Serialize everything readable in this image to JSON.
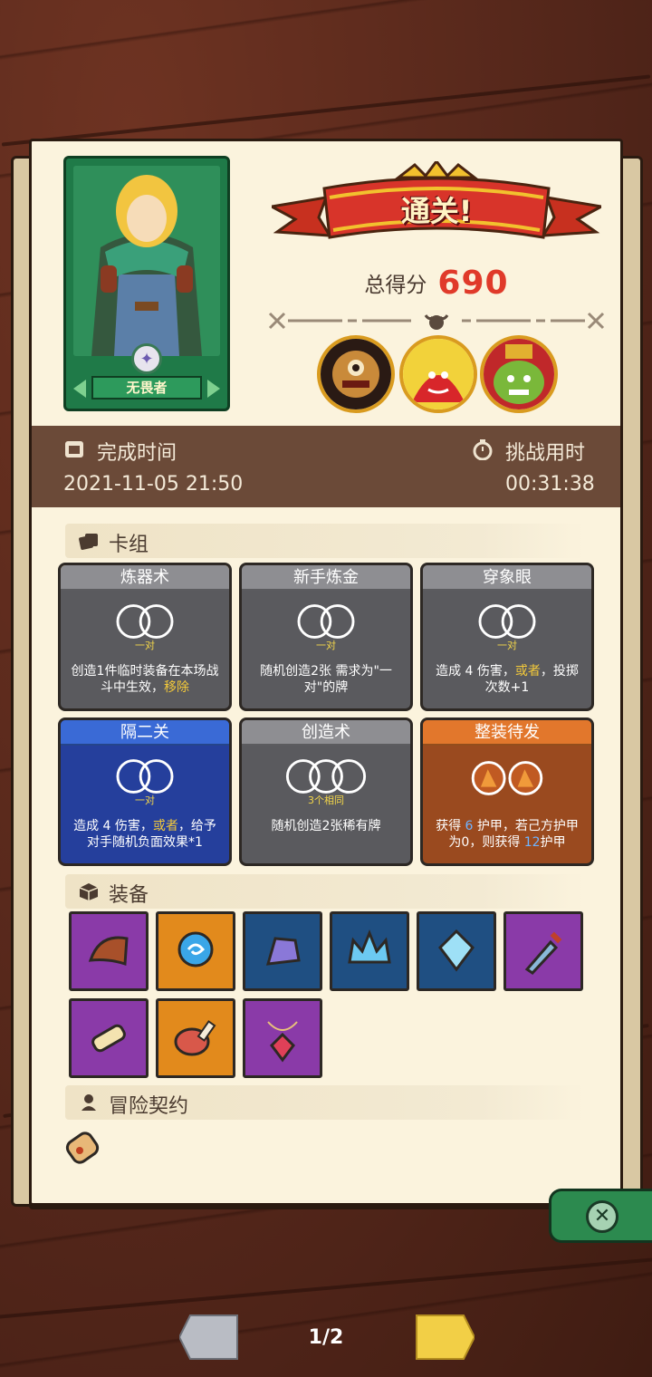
{
  "hero": {
    "name": "无畏者"
  },
  "banner": {
    "text": "通关!"
  },
  "score": {
    "label": "总得分",
    "value": "690"
  },
  "bosses": [
    "one-eyed-demon",
    "red-demon",
    "green-goblin-king"
  ],
  "time_bar": {
    "finish_label": "完成时间",
    "finish_value": "2021-11-05 21:50",
    "duration_label": "挑战用时",
    "duration_value": "00:31:38"
  },
  "deck": {
    "title": "卡组",
    "cards": [
      {
        "title": "炼器术",
        "dice": "一对",
        "desc_a": "创造1件临时装备在本场战斗中生效，",
        "desc_hl": "移除",
        "desc_b": ""
      },
      {
        "title": "新手炼金",
        "dice": "一对",
        "desc_a": "随机创造2张 需求为\"一对\"的牌",
        "desc_hl": "",
        "desc_b": ""
      },
      {
        "title": "穿象眼",
        "dice": "一对",
        "desc_a": "造成 4 伤害，",
        "desc_hl": "或者",
        "desc_b": "，投掷次数+1"
      },
      {
        "title": "隔二关",
        "dice": "一对",
        "desc_a": "造成 4 伤害，",
        "desc_hl": "或者",
        "desc_b": "，给予对手随机负面效果*1"
      },
      {
        "title": "创造术",
        "dice": "3个相同",
        "desc_a": "随机创造2张稀有牌",
        "desc_hl": "",
        "desc_b": ""
      },
      {
        "title": "整装待发",
        "dice": "",
        "desc_a": "获得 ",
        "armor1": "6",
        "desc_mid": " 护甲，若己方护甲为0，则获得 ",
        "armor2": "12",
        "desc_b": "护甲"
      }
    ]
  },
  "equipment": {
    "title": "装备",
    "items": [
      "leather-armor-icon",
      "blue-orb-icon",
      "purple-crystal-icon",
      "ice-crown-icon",
      "diamond-icon",
      "dagger-icon",
      "scroll-charm-icon",
      "ham-icon",
      "red-gem-necklace-icon"
    ]
  },
  "contract": {
    "title": "冒险契约"
  },
  "pager": {
    "page": "1/2"
  },
  "colors": {
    "accent_red": "#e03a2a",
    "highlight_yellow": "#f3c93a"
  }
}
